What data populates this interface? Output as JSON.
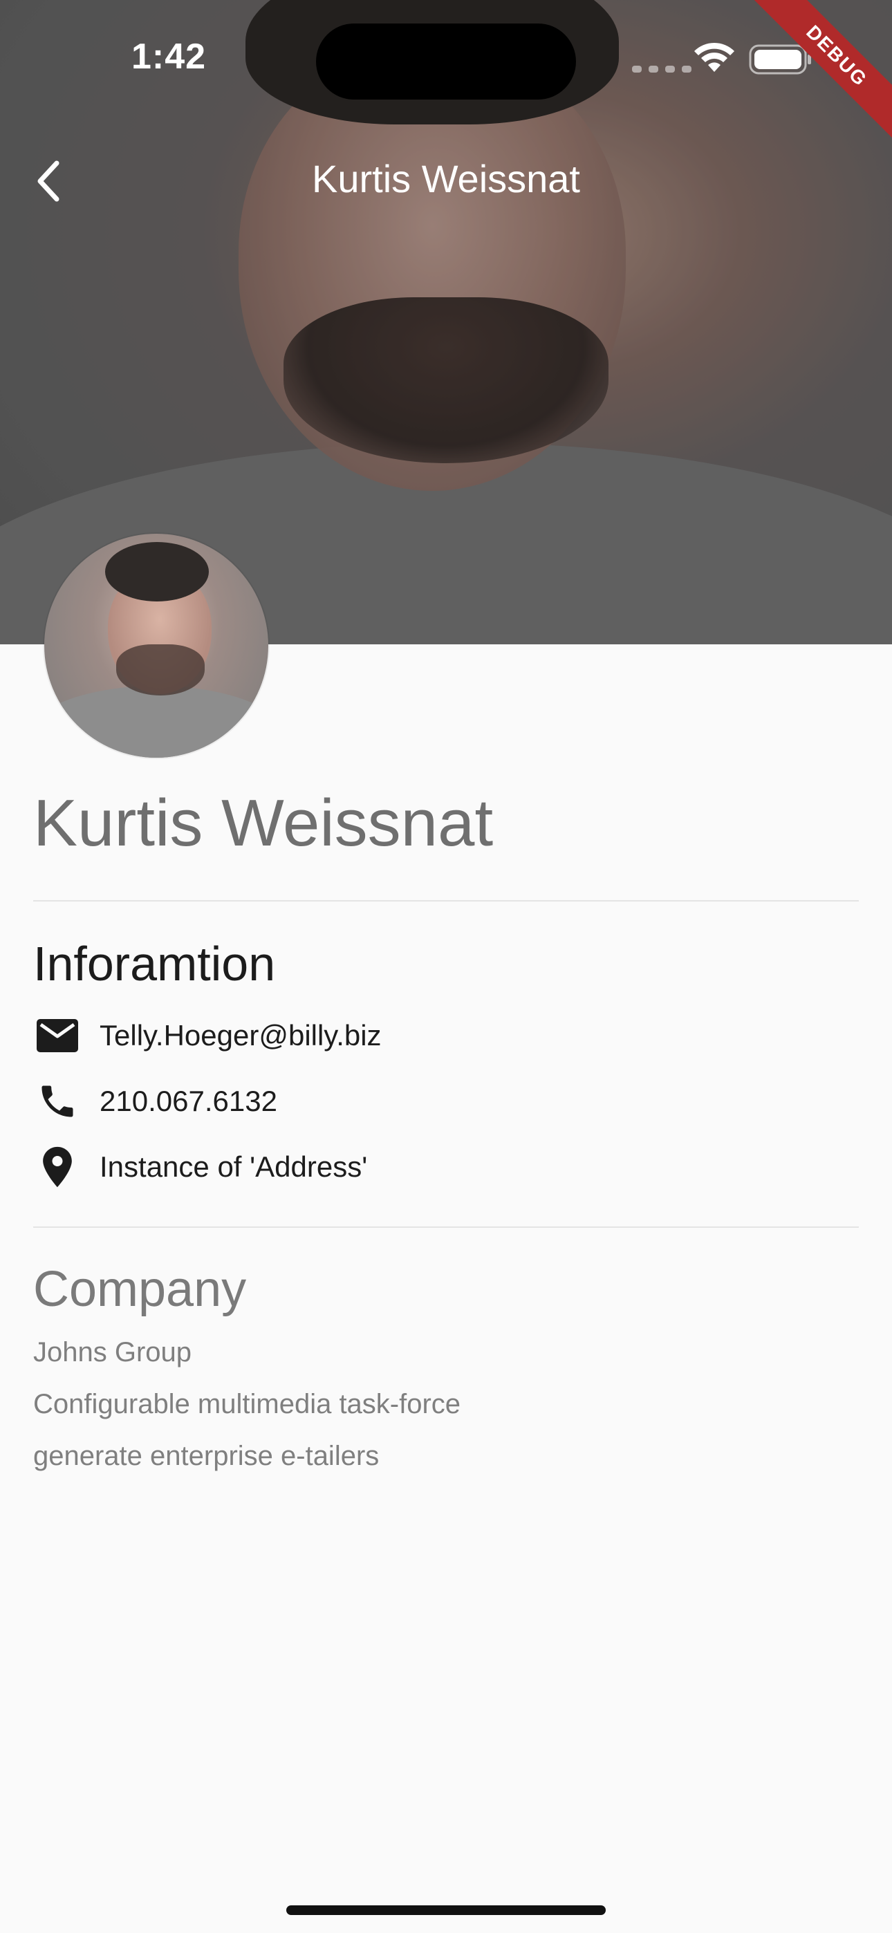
{
  "status_bar": {
    "time": "1:42"
  },
  "debug_banner": "DEBUG",
  "app_bar": {
    "title": "Kurtis Weissnat"
  },
  "profile": {
    "name": "Kurtis Weissnat"
  },
  "information": {
    "title": "Inforamtion",
    "email": "Telly.Hoeger@billy.biz",
    "phone": "210.067.6132",
    "address": "Instance of 'Address'"
  },
  "company": {
    "title": "Company",
    "name": "Johns Group",
    "catch_phrase": "Configurable multimedia task-force",
    "bs": "generate enterprise e-tailers"
  },
  "colors": {
    "background": "#fafafa",
    "ribbon": "#b02a2a",
    "icon": "#1c1c1c"
  },
  "icons": [
    "back-arrow-icon",
    "email-icon",
    "phone-icon",
    "location-pin-icon",
    "wifi-icon",
    "battery-icon"
  ]
}
